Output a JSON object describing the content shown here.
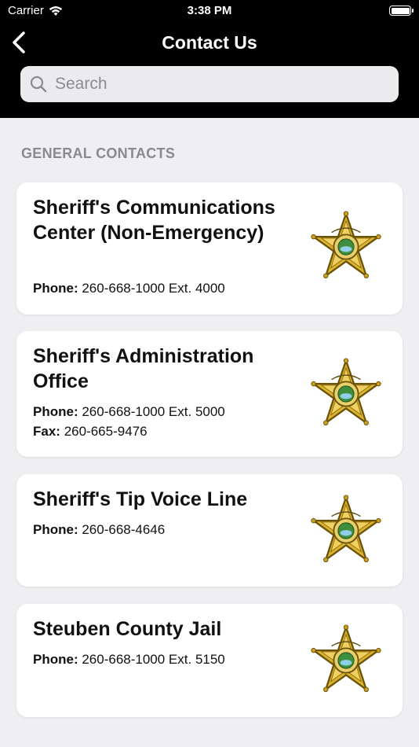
{
  "status_bar": {
    "carrier": "Carrier",
    "time": "3:38 PM"
  },
  "nav": {
    "title": "Contact Us"
  },
  "search": {
    "placeholder": "Search"
  },
  "section": {
    "title": "GENERAL CONTACTS"
  },
  "contacts": [
    {
      "name": "Sheriff's Communications Center (Non-Emergency)",
      "phone_label": "Phone:",
      "phone": "260-668-1000 Ext. 4000"
    },
    {
      "name": "Sheriff's Administration Office",
      "phone_label": "Phone:",
      "phone": "260-668-1000 Ext. 5000",
      "fax_label": "Fax:",
      "fax": "260-665-9476"
    },
    {
      "name": "Sheriff's Tip Voice Line",
      "phone_label": "Phone:",
      "phone": "260-668-4646"
    },
    {
      "name": "Steuben County Jail",
      "phone_label": "Phone:",
      "phone": "260-668-1000 Ext. 5150"
    }
  ],
  "badge_icon": "sheriff-star-badge",
  "colors": {
    "header": "#000000",
    "background": "#efeff1",
    "badge_gold": "#d9b22a"
  }
}
